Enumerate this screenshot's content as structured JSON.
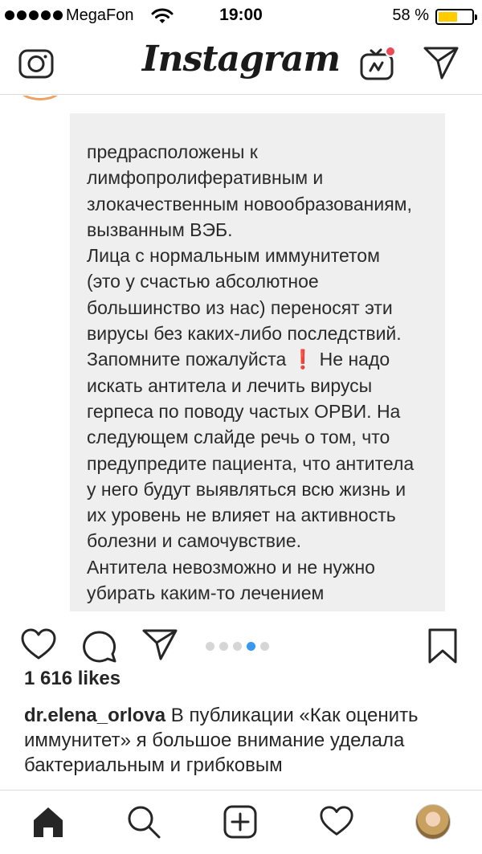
{
  "status_bar": {
    "carrier": "MegaFon",
    "time": "19:00",
    "battery_percent": "58 %",
    "battery_level": 0.58
  },
  "header": {
    "brand": "Instagram",
    "left_icon": "camera-icon",
    "right_icons": [
      "igtv-icon",
      "direct-message-icon"
    ]
  },
  "post": {
    "slide_lines": [
      "предрасположены к",
      "лимфопролиферативным и",
      "злокачественным новообразованиям,",
      "вызванным ВЭБ.",
      "Лица с нормальным иммунитетом",
      "(это у счастью абсолютное",
      "большинство из нас) переносят эти",
      "вирусы без каких-либо последствий.",
      "Запомните пожалуйста",
      "искать антитела и лечить вирусы",
      "герпеса по поводу частых ОРВИ. На",
      "следующем слайде речь о том, что",
      "предупредите пациента, что антитела",
      "у него будут выявляться всю жизнь и",
      "их уровень не влияет на активность",
      "болезни и самочувствие.",
      "Антитела невозможно и не нужно",
      "убирать каким-то лечением"
    ],
    "slide_line_9_emoji": "❗",
    "slide_line_9_tail": "Не надо",
    "carousel": {
      "count": 5,
      "active_index": 3
    },
    "likes": "1 616 likes",
    "caption_user": "dr.elena_orlova",
    "caption_text": "В публикации «Как оценить иммунитет» я большое внимание уделала бактериальным и грибковым"
  },
  "actions": [
    "heart-icon",
    "comment-icon",
    "share-icon",
    "bookmark-icon"
  ],
  "tab_bar": [
    "home-icon",
    "search-icon",
    "new-post-icon",
    "activity-icon",
    "profile-avatar"
  ],
  "colors": {
    "accent_blue": "#3897f0",
    "battery": "#ffcc00",
    "igtv_badge": "#ed4956",
    "exclaim_red": "#e0282e",
    "slide_bg": "#efefef"
  }
}
